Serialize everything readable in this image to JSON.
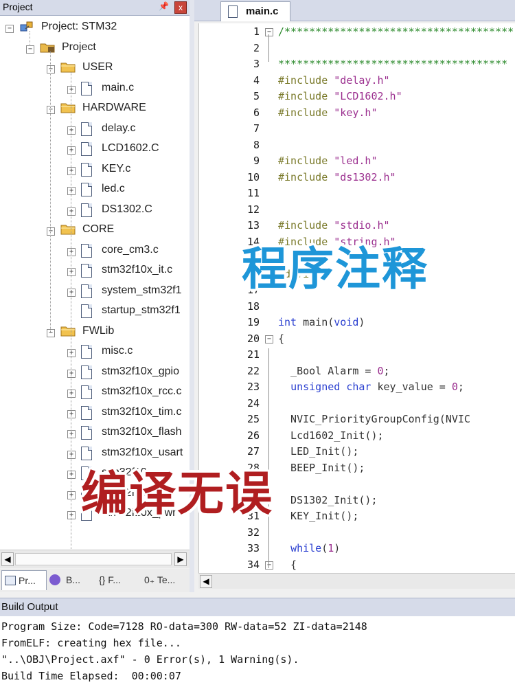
{
  "project_pane": {
    "title": "Project",
    "pin": "ᵽ",
    "close": "x",
    "tree": [
      {
        "label": "Project: STM32",
        "type": "root"
      },
      {
        "label": "Project",
        "type": "target"
      },
      {
        "label": "USER",
        "type": "group"
      },
      {
        "label": "main.c",
        "type": "file"
      },
      {
        "label": "HARDWARE",
        "type": "group"
      },
      {
        "label": "delay.c",
        "type": "file"
      },
      {
        "label": "LCD1602.C",
        "type": "file"
      },
      {
        "label": "KEY.c",
        "type": "file"
      },
      {
        "label": "led.c",
        "type": "file"
      },
      {
        "label": "DS1302.C",
        "type": "file"
      },
      {
        "label": "CORE",
        "type": "group"
      },
      {
        "label": "core_cm3.c",
        "type": "file"
      },
      {
        "label": "stm32f10x_it.c",
        "type": "file"
      },
      {
        "label": "system_stm32f1",
        "type": "file"
      },
      {
        "label": "startup_stm32f1",
        "type": "file"
      },
      {
        "label": "FWLib",
        "type": "group"
      },
      {
        "label": "misc.c",
        "type": "file"
      },
      {
        "label": "stm32f10x_gpio",
        "type": "file"
      },
      {
        "label": "stm32f10x_rcc.c",
        "type": "file"
      },
      {
        "label": "stm32f10x_tim.c",
        "type": "file"
      },
      {
        "label": "stm32f10x_flash",
        "type": "file"
      },
      {
        "label": "stm32f10x_usart",
        "type": "file"
      },
      {
        "label": "stm32f10x_",
        "type": "file"
      },
      {
        "label": "stm32f10x_",
        "type": "file"
      },
      {
        "label": "stm32f10x_pwr",
        "type": "file"
      }
    ],
    "tabs": [
      {
        "label": "Pr..."
      },
      {
        "label": "B..."
      },
      {
        "label": "{} F..."
      },
      {
        "label": "0₊ Te..."
      }
    ]
  },
  "editor": {
    "tab_label": "main.c",
    "lines": [
      {
        "n": "1",
        "text": "/*************************************",
        "cls": "c-comment",
        "fold": "−"
      },
      {
        "n": "2",
        "text": "",
        "cls": "c-id",
        "fold": ""
      },
      {
        "n": "3",
        "text": "*************************************",
        "cls": "c-comment",
        "fold": ""
      },
      {
        "n": "4",
        "text": "#include \"delay.h\"",
        "cls": "pre",
        "fold": ""
      },
      {
        "n": "5",
        "text": "#include \"LCD1602.h\"",
        "cls": "pre",
        "fold": ""
      },
      {
        "n": "6",
        "text": "#include \"key.h\"",
        "cls": "pre",
        "fold": ""
      },
      {
        "n": "7",
        "text": "",
        "cls": "c-id",
        "fold": ""
      },
      {
        "n": "8",
        "text": "",
        "cls": "c-id",
        "fold": ""
      },
      {
        "n": "9",
        "text": "#include \"led.h\"",
        "cls": "pre",
        "fold": ""
      },
      {
        "n": "10",
        "text": "#include \"ds1302.h\"",
        "cls": "pre",
        "fold": ""
      },
      {
        "n": "11",
        "text": "",
        "cls": "c-id",
        "fold": ""
      },
      {
        "n": "12",
        "text": "",
        "cls": "c-id",
        "fold": ""
      },
      {
        "n": "13",
        "text": "#include \"stdio.h\"",
        "cls": "pre",
        "fold": ""
      },
      {
        "n": "14",
        "text": "#include \"string.h\"",
        "cls": "pre",
        "fold": ""
      },
      {
        "n": "15",
        "text": "",
        "cls": "c-id",
        "fold": ""
      },
      {
        "n": "16",
        "text": "#define",
        "cls": "c-pre",
        "fold": ""
      },
      {
        "n": "17",
        "text": "",
        "cls": "c-id",
        "fold": ""
      },
      {
        "n": "18",
        "text": "",
        "cls": "c-id",
        "fold": ""
      },
      {
        "n": "19",
        "text": "int main(void)",
        "cls": "main",
        "fold": ""
      },
      {
        "n": "20",
        "text": "{",
        "cls": "c-id",
        "fold": "−"
      },
      {
        "n": "21",
        "text": "",
        "cls": "c-id",
        "fold": ""
      },
      {
        "n": "22",
        "text": "  _Bool Alarm = 0;",
        "cls": "bool",
        "fold": ""
      },
      {
        "n": "23",
        "text": "  unsigned char key_value = 0;",
        "cls": "uchar",
        "fold": ""
      },
      {
        "n": "24",
        "text": "",
        "cls": "c-id",
        "fold": ""
      },
      {
        "n": "25",
        "text": "  NVIC_PriorityGroupConfig(NVIC",
        "cls": "c-id",
        "fold": ""
      },
      {
        "n": "26",
        "text": "  Lcd1602_Init();",
        "cls": "c-id",
        "fold": ""
      },
      {
        "n": "27",
        "text": "  LED_Init();",
        "cls": "c-id",
        "fold": ""
      },
      {
        "n": "28",
        "text": "  BEEP_Init();",
        "cls": "c-id",
        "fold": ""
      },
      {
        "n": "29",
        "text": "",
        "cls": "c-id",
        "fold": ""
      },
      {
        "n": "30",
        "text": "  DS1302_Init();",
        "cls": "c-id",
        "fold": ""
      },
      {
        "n": "31",
        "text": "  KEY_Init();",
        "cls": "c-id",
        "fold": ""
      },
      {
        "n": "32",
        "text": "",
        "cls": "c-id",
        "fold": ""
      },
      {
        "n": "33",
        "text": "  while(1)",
        "cls": "while",
        "fold": ""
      },
      {
        "n": "34",
        "text": "  {",
        "cls": "c-id",
        "fold": "−"
      }
    ]
  },
  "build_output": {
    "title": "Build Output",
    "lines": [
      "Program Size: Code=7128 RO-data=300 RW-data=52 ZI-data=2148",
      "FromELF: creating hex file...",
      "\"..\\OBJ\\Project.axf\" - 0 Error(s), 1 Warning(s).",
      "Build Time Elapsed:  00:00:07"
    ]
  },
  "overlays": {
    "top": "程序注释",
    "bottom": "编译无误"
  },
  "colors": {
    "overlay_top": "#1e96d8",
    "overlay_bottom": "#b01e20",
    "comment": "#2e8b2e",
    "keyword": "#2a3fd0",
    "string": "#9b2f8f"
  }
}
